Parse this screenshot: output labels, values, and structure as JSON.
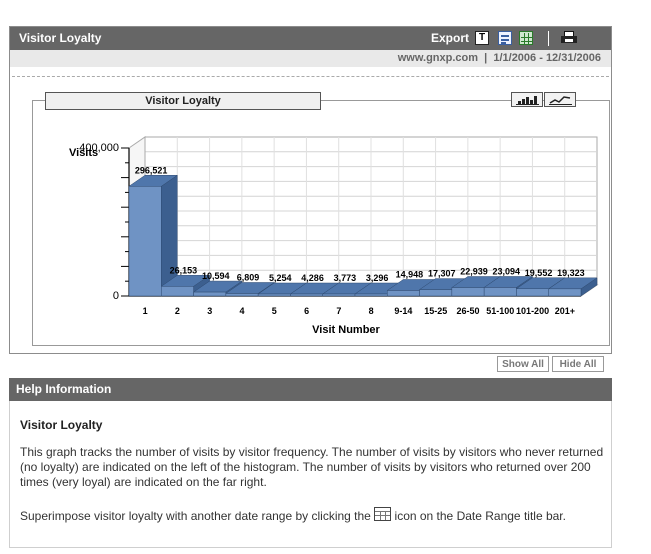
{
  "report": {
    "title": "Visitor Loyalty",
    "export_label": "Export",
    "export_txt_glyph": "T",
    "site": "www.gnxp.com",
    "separator": "|",
    "date_range": "1/1/2006 - 12/31/2006",
    "icons": [
      "text-export-icon",
      "csv-export-icon",
      "excel-export-icon",
      "print-icon"
    ]
  },
  "chart_panel": {
    "title": "Visitor Loyalty",
    "show_all": "Show All",
    "hide_all": "Hide All"
  },
  "chart_data": {
    "type": "bar",
    "categories": [
      "1",
      "2",
      "3",
      "4",
      "5",
      "6",
      "7",
      "8",
      "9-14",
      "15-25",
      "26-50",
      "51-100",
      "101-200",
      "201+"
    ],
    "values": [
      296521,
      26153,
      10594,
      6809,
      5254,
      4286,
      3773,
      3296,
      14948,
      17307,
      22939,
      23094,
      19552,
      19323
    ],
    "value_labels": [
      "296,521",
      "26,153",
      "10,594",
      "6,809",
      "5,254",
      "4,286",
      "3,773",
      "3,296",
      "14,948",
      "17,307",
      "22,939",
      "23,094",
      "19,552",
      "19,323"
    ],
    "xlabel": "Visit Number",
    "ylabel": "Visits",
    "ytick_labels": [
      "400,000",
      "0"
    ],
    "ylim": [
      0,
      400000
    ],
    "grid": true,
    "colors": {
      "bar_front": "#6f93c4",
      "bar_top": "#4f76ab",
      "bar_side": "#3c5f8f"
    }
  },
  "help": {
    "title": "Help Information",
    "subtitle": "Visitor Loyalty",
    "paragraph1": "This graph tracks the number of visits by visitor frequency. The number of visits by visitors who never returned (no loyalty) are indicated on the left of the histogram. The number of visits by visitors who returned over 200 times (very loyal) are indicated on the far right.",
    "paragraph2_before": "Superimpose visitor loyalty with another date range by clicking the ",
    "paragraph2_after": " icon on the Date Range title bar."
  }
}
